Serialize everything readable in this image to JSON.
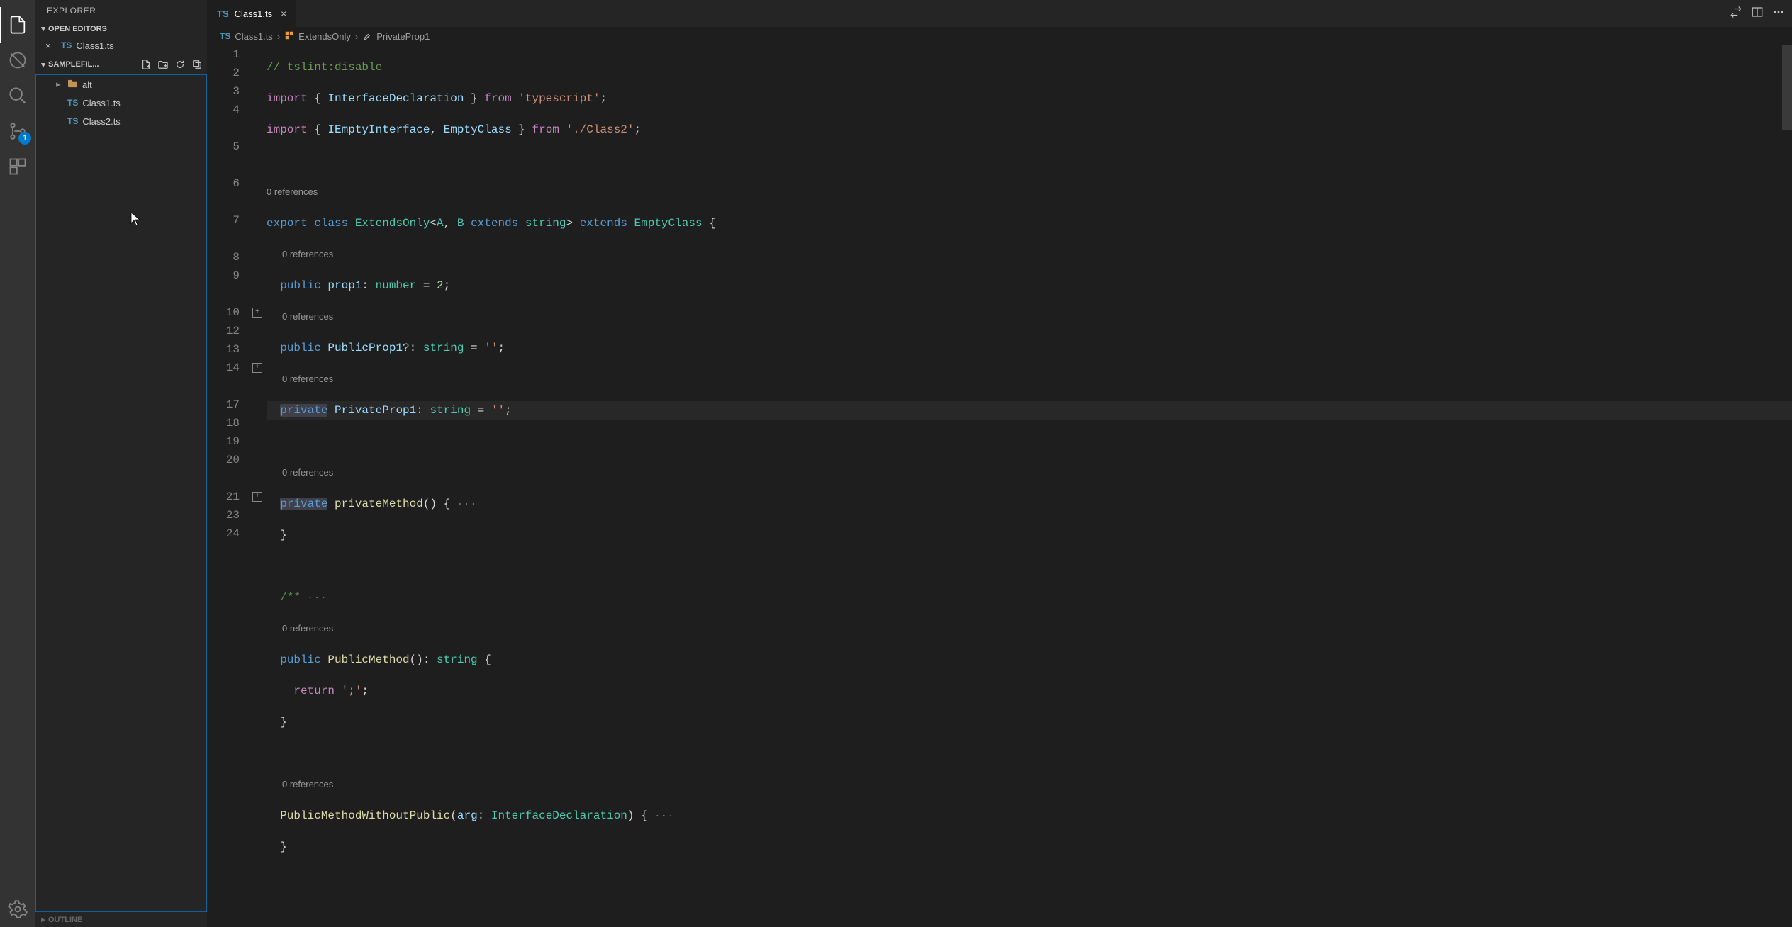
{
  "activity_bar": {
    "scm_badge": "1"
  },
  "sidebar": {
    "title": "EXPLORER",
    "open_editors": {
      "header": "OPEN EDITORS",
      "items": [
        {
          "icon": "TS",
          "name": "Class1.ts"
        }
      ]
    },
    "workspace": {
      "header": "SAMPLEFIL...",
      "items": [
        {
          "kind": "folder",
          "name": "alt"
        },
        {
          "kind": "ts",
          "name": "Class1.ts"
        },
        {
          "kind": "ts",
          "name": "Class2.ts"
        }
      ]
    },
    "outline_header": "OUTLINE"
  },
  "tabbar": {
    "tabs": [
      {
        "icon": "TS",
        "label": "Class1.ts"
      }
    ]
  },
  "breadcrumbs": {
    "file_icon": "TS",
    "file": "Class1.ts",
    "sym1": "ExtendsOnly",
    "sym2": "PrivateProp1"
  },
  "codelens": {
    "zero_refs": "0 references"
  },
  "lineno": {
    "l1": "1",
    "l2": "2",
    "l3": "3",
    "l4": "4",
    "l5": "5",
    "l6": "6",
    "l7": "7",
    "l8": "8",
    "l9": "9",
    "l10": "10",
    "l12": "12",
    "l13": "13",
    "l14": "14",
    "l17": "17",
    "l18": "18",
    "l19": "19",
    "l20": "20",
    "l21": "21",
    "l23": "23",
    "l24": "24"
  },
  "code": {
    "l1_comment": "// tslint:disable",
    "l2_import": "import",
    "l2_brace_open": " { ",
    "l2_iface": "InterfaceDeclaration",
    "l2_brace_close": " } ",
    "l2_from": "from",
    "l2_mod": " 'typescript'",
    "semi": ";",
    "l3_import": "import",
    "l3_brace_open": " { ",
    "l3_a": "IEmptyInterface",
    "l3_comma": ", ",
    "l3_b": "EmptyClass",
    "l3_brace_close": " } ",
    "l3_from": "from",
    "l3_mod": " './Class2'",
    "l5_export": "export",
    "l5_class": " class",
    "l5_name": " ExtendsOnly",
    "l5_lt": "<",
    "l5_A": "A",
    "l5_cm": ", ",
    "l5_B": "B ",
    "l5_extends1": "extends",
    "l5_string": " string",
    "l5_gt": "> ",
    "l5_extends2": "extends",
    "l5_sup": " EmptyClass",
    "l5_open": " {",
    "indent2": "  ",
    "indent4": "    ",
    "l6_public": "public",
    "l6_prop": " prop1",
    "l6_colon": ": ",
    "l6_type": "number",
    "l6_eq": " = ",
    "l6_val": "2",
    "l7_public": "public",
    "l7_prop": " PublicProp1?",
    "l7_colon": ": ",
    "l7_type": "string",
    "l7_eq": " = ",
    "l7_val": "''",
    "l8_private": "private",
    "l8_prop": " PrivateProp1",
    "l8_colon": ": ",
    "l8_type": "string",
    "l8_eq": " = ",
    "l8_val": "''",
    "l10_private": "private",
    "l10_fn": " privateMethod",
    "l10_paren": "() {",
    "l12_brace": "}",
    "l14_doc": "/**",
    "l17_public": "public",
    "l17_fn": " PublicMethod",
    "l17_sig": "(): ",
    "l17_type": "string",
    "l17_open": " {",
    "l18_return": "return",
    "l18_val": " ';'",
    "l19_brace": "}",
    "l21_fn": "PublicMethodWithoutPublic",
    "l21_open": "(",
    "l21_arg": "arg",
    "l21_colon": ": ",
    "l21_argtype": "InterfaceDeclaration",
    "l21_close": ") {",
    "l23_brace": "}",
    "dots": " ···"
  }
}
